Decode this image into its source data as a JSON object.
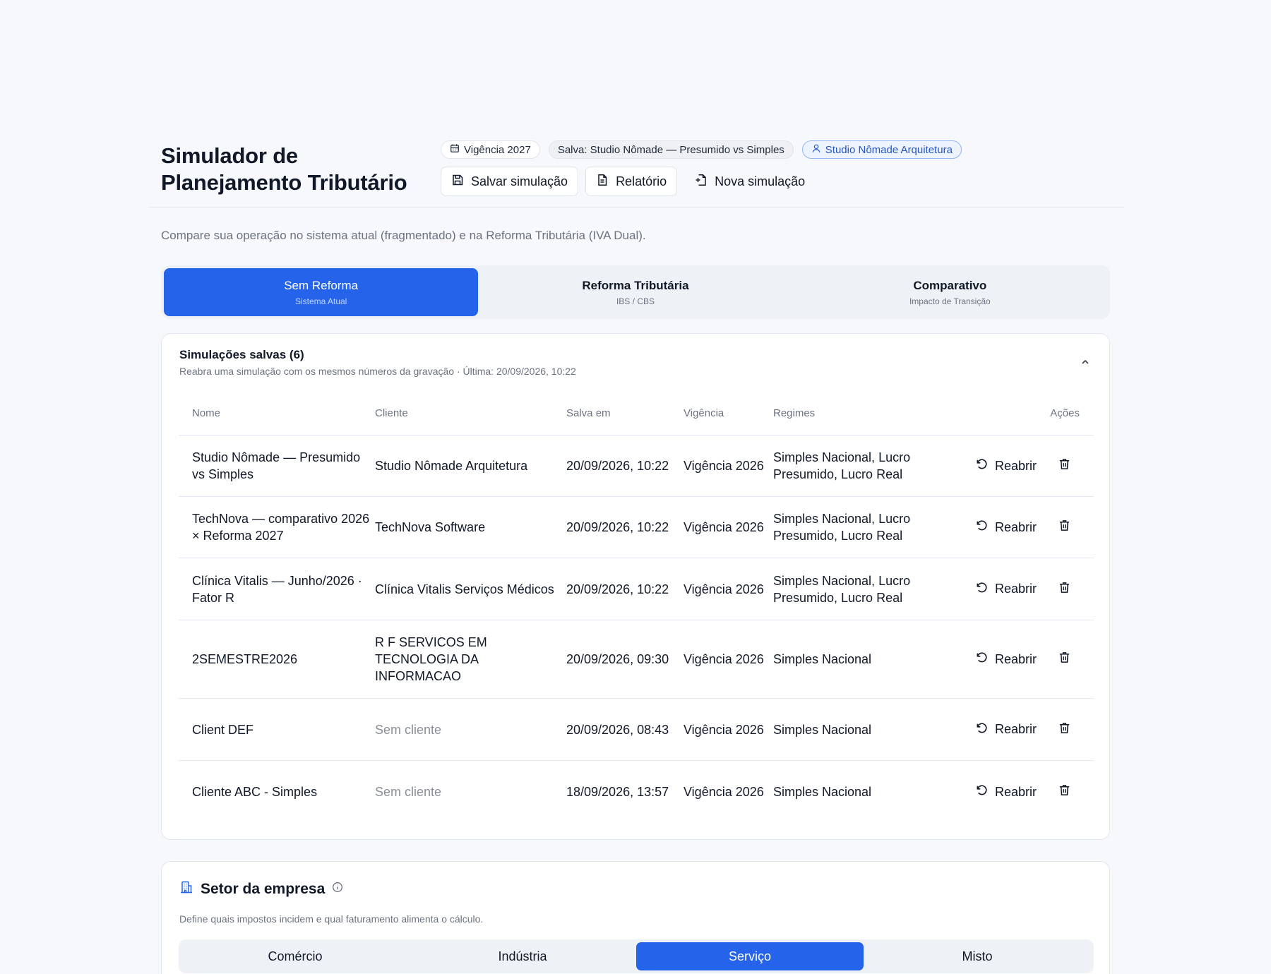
{
  "header": {
    "title": "Simulador de Planejamento Tributário",
    "chips": {
      "vigencia": "Vigência 2027",
      "saved": "Salva: Studio Nômade — Presumido vs Simples",
      "client": "Studio Nômade Arquitetura"
    },
    "actions": {
      "save": "Salvar simulação",
      "report": "Relatório",
      "new": "Nova simulação"
    }
  },
  "subtitle": "Compare sua operação no sistema atual (fragmentado) e na Reforma Tributária (IVA Dual).",
  "tabs": [
    {
      "label": "Sem Reforma",
      "sub": "Sistema Atual",
      "active": true
    },
    {
      "label": "Reforma Tributária",
      "sub": "IBS / CBS",
      "active": false
    },
    {
      "label": "Comparativo",
      "sub": "Impacto de Transição",
      "active": false
    }
  ],
  "saved": {
    "title": "Simulações salvas (6)",
    "subtitle": "Reabra uma simulação com os mesmos números da gravação · Última: 20/09/2026, 10:22",
    "columns": {
      "name": "Nome",
      "client": "Cliente",
      "saved_at": "Salva em",
      "vigencia": "Vigência",
      "regimes": "Regimes",
      "actions": "Ações"
    },
    "reopen_label": "Reabrir",
    "rows": [
      {
        "name": "Studio Nômade — Presumido vs Simples",
        "client": "Studio Nômade Arquitetura",
        "saved_at": "20/09/2026, 10:22",
        "vigencia": "Vigência 2026",
        "regimes": "Simples Nacional, Lucro Presumido, Lucro Real"
      },
      {
        "name": "TechNova — comparativo 2026 × Reforma 2027",
        "client": "TechNova Software",
        "saved_at": "20/09/2026, 10:22",
        "vigencia": "Vigência 2026",
        "regimes": "Simples Nacional, Lucro Presumido, Lucro Real"
      },
      {
        "name": "Clínica Vitalis — Junho/2026 · Fator R",
        "client": "Clínica Vitalis Serviços Médicos",
        "saved_at": "20/09/2026, 10:22",
        "vigencia": "Vigência 2026",
        "regimes": "Simples Nacional, Lucro Presumido, Lucro Real"
      },
      {
        "name": "2SEMESTRE2026",
        "client": "R F SERVICOS EM TECNOLOGIA DA INFORMACAO",
        "saved_at": "20/09/2026, 09:30",
        "vigencia": "Vigência 2026",
        "regimes": "Simples Nacional"
      },
      {
        "name": "Client DEF",
        "client": "Sem cliente",
        "saved_at": "20/09/2026, 08:43",
        "vigencia": "Vigência 2026",
        "regimes": "Simples Nacional"
      },
      {
        "name": "Cliente ABC - Simples",
        "client": "Sem cliente",
        "saved_at": "18/09/2026, 13:57",
        "vigencia": "Vigência 2026",
        "regimes": "Simples Nacional"
      }
    ]
  },
  "sector": {
    "title": "Setor da empresa",
    "subtitle": "Define quais impostos incidem e qual faturamento alimenta o cálculo.",
    "options": [
      "Comércio",
      "Indústria",
      "Serviço",
      "Misto"
    ],
    "selected": "Serviço"
  },
  "colors": {
    "accent": "#2563eb",
    "background": "#f7f8fb"
  }
}
